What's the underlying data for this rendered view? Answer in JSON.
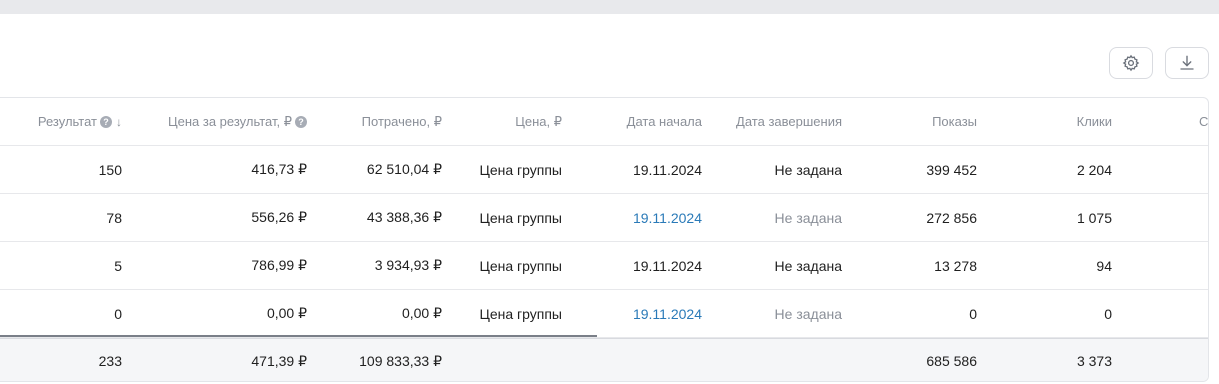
{
  "toolbar": {
    "settings_icon": "gear-icon",
    "download_icon": "download-icon"
  },
  "table": {
    "headers": {
      "result": "Результат",
      "price_per_result": "Цена за результат, ₽",
      "spent": "Потрачено, ₽",
      "bid": "Цена, ₽",
      "start_date": "Дата начала",
      "end_date": "Дата завершения",
      "shows": "Показы",
      "clicks": "Клики",
      "cut": "С"
    },
    "rows": [
      {
        "result": "150",
        "price_per_result": "416,73 ₽",
        "spent": "62 510,04 ₽",
        "bid": "Цена группы",
        "start_date": "19.11.2024",
        "end_date": "Не задана",
        "shows": "399 452",
        "clicks": "2 204"
      },
      {
        "result": "78",
        "price_per_result": "556,26 ₽",
        "spent": "43 388,36 ₽",
        "bid": "Цена группы",
        "start_date": "19.11.2024",
        "end_date": "Не задана",
        "shows": "272 856",
        "clicks": "1 075"
      },
      {
        "result": "5",
        "price_per_result": "786,99 ₽",
        "spent": "3 934,93 ₽",
        "bid": "Цена группы",
        "start_date": "19.11.2024",
        "end_date": "Не задана",
        "shows": "13 278",
        "clicks": "94"
      },
      {
        "result": "0",
        "price_per_result": "0,00 ₽",
        "spent": "0,00 ₽",
        "bid": "Цена группы",
        "start_date": "19.11.2024",
        "end_date": "Не задана",
        "shows": "0",
        "clicks": "0"
      }
    ],
    "totals": {
      "result": "233",
      "price_per_result": "471,39 ₽",
      "spent": "109 833,33 ₽",
      "shows": "685 586",
      "clicks": "3 373"
    }
  },
  "colors": {
    "link": "#2a7ab8",
    "muted": "#8a8f98"
  }
}
